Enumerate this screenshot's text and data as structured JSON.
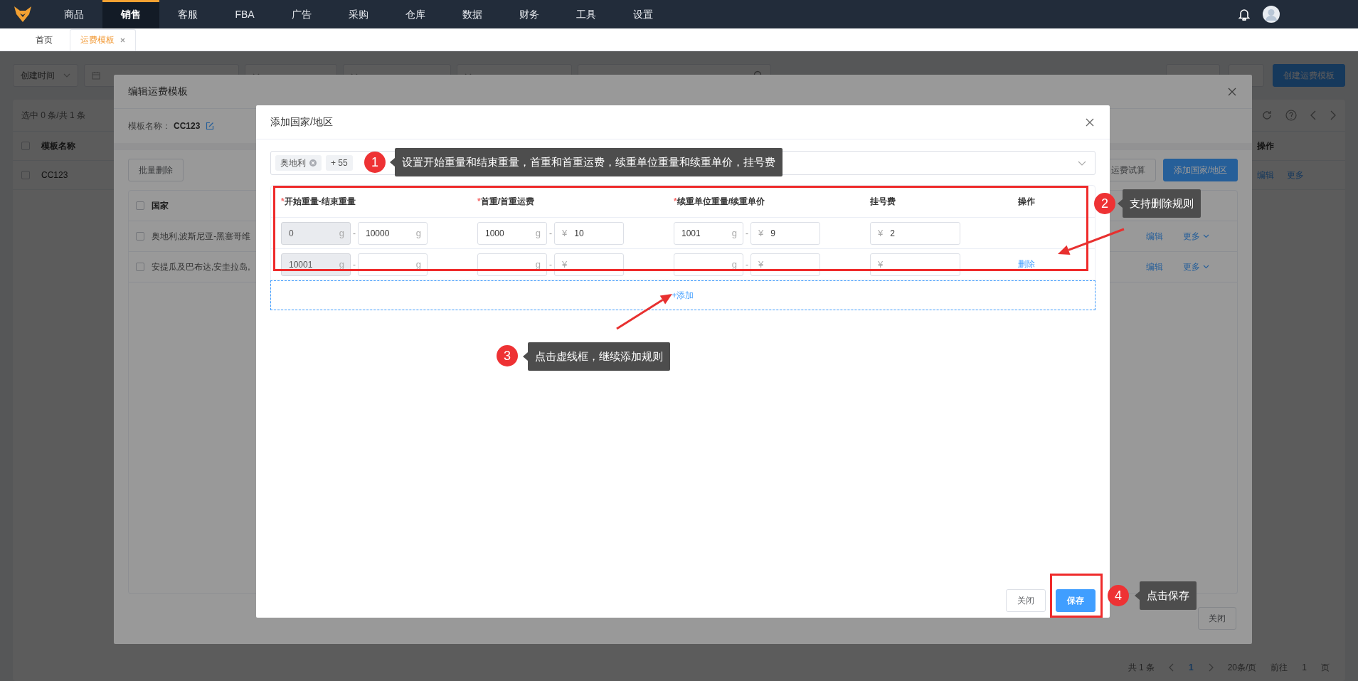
{
  "top_nav": {
    "items": [
      {
        "label": "商品",
        "selected": false
      },
      {
        "label": "销售",
        "selected": true
      },
      {
        "label": "客服",
        "selected": false
      },
      {
        "label": "FBA",
        "selected": false
      },
      {
        "label": "广告",
        "selected": false
      },
      {
        "label": "采购",
        "selected": false
      },
      {
        "label": "仓库",
        "selected": false
      },
      {
        "label": "数据",
        "selected": false
      },
      {
        "label": "财务",
        "selected": false
      },
      {
        "label": "工具",
        "selected": false
      },
      {
        "label": "设置",
        "selected": false
      }
    ]
  },
  "tabs": [
    {
      "label": "首页",
      "selected": false,
      "closable": false
    },
    {
      "label": "运费模板",
      "selected": true,
      "closable": true
    }
  ],
  "filters": [
    {
      "kind": "select",
      "value": "创建时间"
    },
    {
      "kind": "date_range"
    },
    {
      "kind": "select"
    },
    {
      "kind": "select"
    },
    {
      "kind": "select"
    },
    {
      "kind": "search"
    }
  ],
  "page_actions": [
    {
      "primary": false
    },
    {
      "primary": false
    },
    {
      "label": "创建运费模板",
      "primary": true
    }
  ],
  "list": {
    "summary": "选中 0 条/共 1 条",
    "select_all_checked": false,
    "columns": [
      "模板名称",
      "操作"
    ],
    "rows": [
      {
        "name": "CC123",
        "checked": false,
        "actions": [
          "编辑",
          "更多"
        ]
      }
    ]
  },
  "pagination": {
    "total": "共 1 条",
    "pages": [
      {
        "label": "1",
        "selected": true
      }
    ],
    "page_size": "20条/页",
    "goto_label": "前往",
    "goto_value": "1",
    "goto_suffix": "页"
  },
  "edit_dialog": {
    "title": "编辑运费模板",
    "name_label": "模板名称：",
    "name_value": "CC123",
    "batch_delete": "批量删除",
    "actions": [
      {
        "label": "运费试算",
        "primary": false
      },
      {
        "label": "添加国家/地区",
        "primary": true
      }
    ],
    "table": {
      "select_all_checked": false,
      "columns": [
        "国家"
      ],
      "rows": [
        {
          "countries": "奥地利,波斯尼亚-黑塞哥维",
          "checked": false,
          "actions": [
            "编辑",
            "更多"
          ]
        },
        {
          "countries": "安提瓜及巴布达,安圭拉岛,",
          "checked": false,
          "actions": [
            "编辑",
            "更多"
          ]
        }
      ]
    },
    "close_button": "关闭"
  },
  "add_dialog": {
    "title": "添加国家/地区",
    "countries": {
      "tags": [
        {
          "label": "奥地利",
          "closable": true
        }
      ],
      "more": "+ 55"
    },
    "rules": {
      "columns": [
        {
          "label": "开始重量-结束重量",
          "required_mark": "*"
        },
        {
          "label": "首重/首重运费",
          "required_mark": "*"
        },
        {
          "label": "续重单位重量/续重单价",
          "required_mark": "*"
        },
        {
          "label": "挂号费"
        },
        {
          "label": "操作"
        }
      ],
      "rows": [
        {
          "groups": [
            {
              "separator": "-",
              "fields": [
                {
                  "kind": "weight",
                  "value": "0",
                  "unit": "g",
                  "disabled": true
                },
                {
                  "kind": "weight",
                  "value": "10000",
                  "unit": "g",
                  "disabled": false
                }
              ]
            },
            {
              "separator": "-",
              "fields": [
                {
                  "kind": "weight",
                  "value": "1000",
                  "unit": "g",
                  "disabled": false
                },
                {
                  "kind": "money",
                  "value": "10",
                  "unit": "¥",
                  "disabled": false
                }
              ]
            },
            {
              "separator": "-",
              "fields": [
                {
                  "kind": "weight",
                  "value": "1001",
                  "unit": "g",
                  "disabled": false
                },
                {
                  "kind": "money",
                  "value": "9",
                  "unit": "¥",
                  "disabled": false
                }
              ]
            },
            {
              "fields": [
                {
                  "kind": "money",
                  "value": "2",
                  "unit": "¥",
                  "disabled": false
                }
              ]
            }
          ]
        },
        {
          "groups": [
            {
              "separator": "-",
              "fields": [
                {
                  "kind": "weight",
                  "value": "10001",
                  "unit": "g",
                  "disabled": true
                },
                {
                  "kind": "weight",
                  "unit": "g",
                  "disabled": false
                }
              ]
            },
            {
              "separator": "-",
              "fields": [
                {
                  "kind": "weight",
                  "unit": "g",
                  "disabled": false
                },
                {
                  "kind": "money",
                  "unit": "¥",
                  "disabled": false
                }
              ]
            },
            {
              "separator": "-",
              "fields": [
                {
                  "kind": "weight",
                  "unit": "g",
                  "disabled": false
                },
                {
                  "kind": "money",
                  "unit": "¥",
                  "disabled": false
                }
              ]
            },
            {
              "fields": [
                {
                  "kind": "money",
                  "unit": "¥",
                  "disabled": false
                }
              ]
            }
          ],
          "delete_link": "删除"
        }
      ],
      "add_button": "+添加"
    },
    "footer": [
      {
        "label": "关闭",
        "primary": false
      },
      {
        "label": "保存",
        "primary": true
      }
    ]
  },
  "annotations": [
    {
      "number": "1",
      "text": "设置开始重量和结束重量，首重和首重运费，续重单位重量和续重单价，挂号费"
    },
    {
      "number": "2",
      "text": "支持删除规则"
    },
    {
      "number": "3",
      "text": "点击虚线框，继续添加规则"
    },
    {
      "number": "4",
      "text": "点击保存"
    }
  ]
}
